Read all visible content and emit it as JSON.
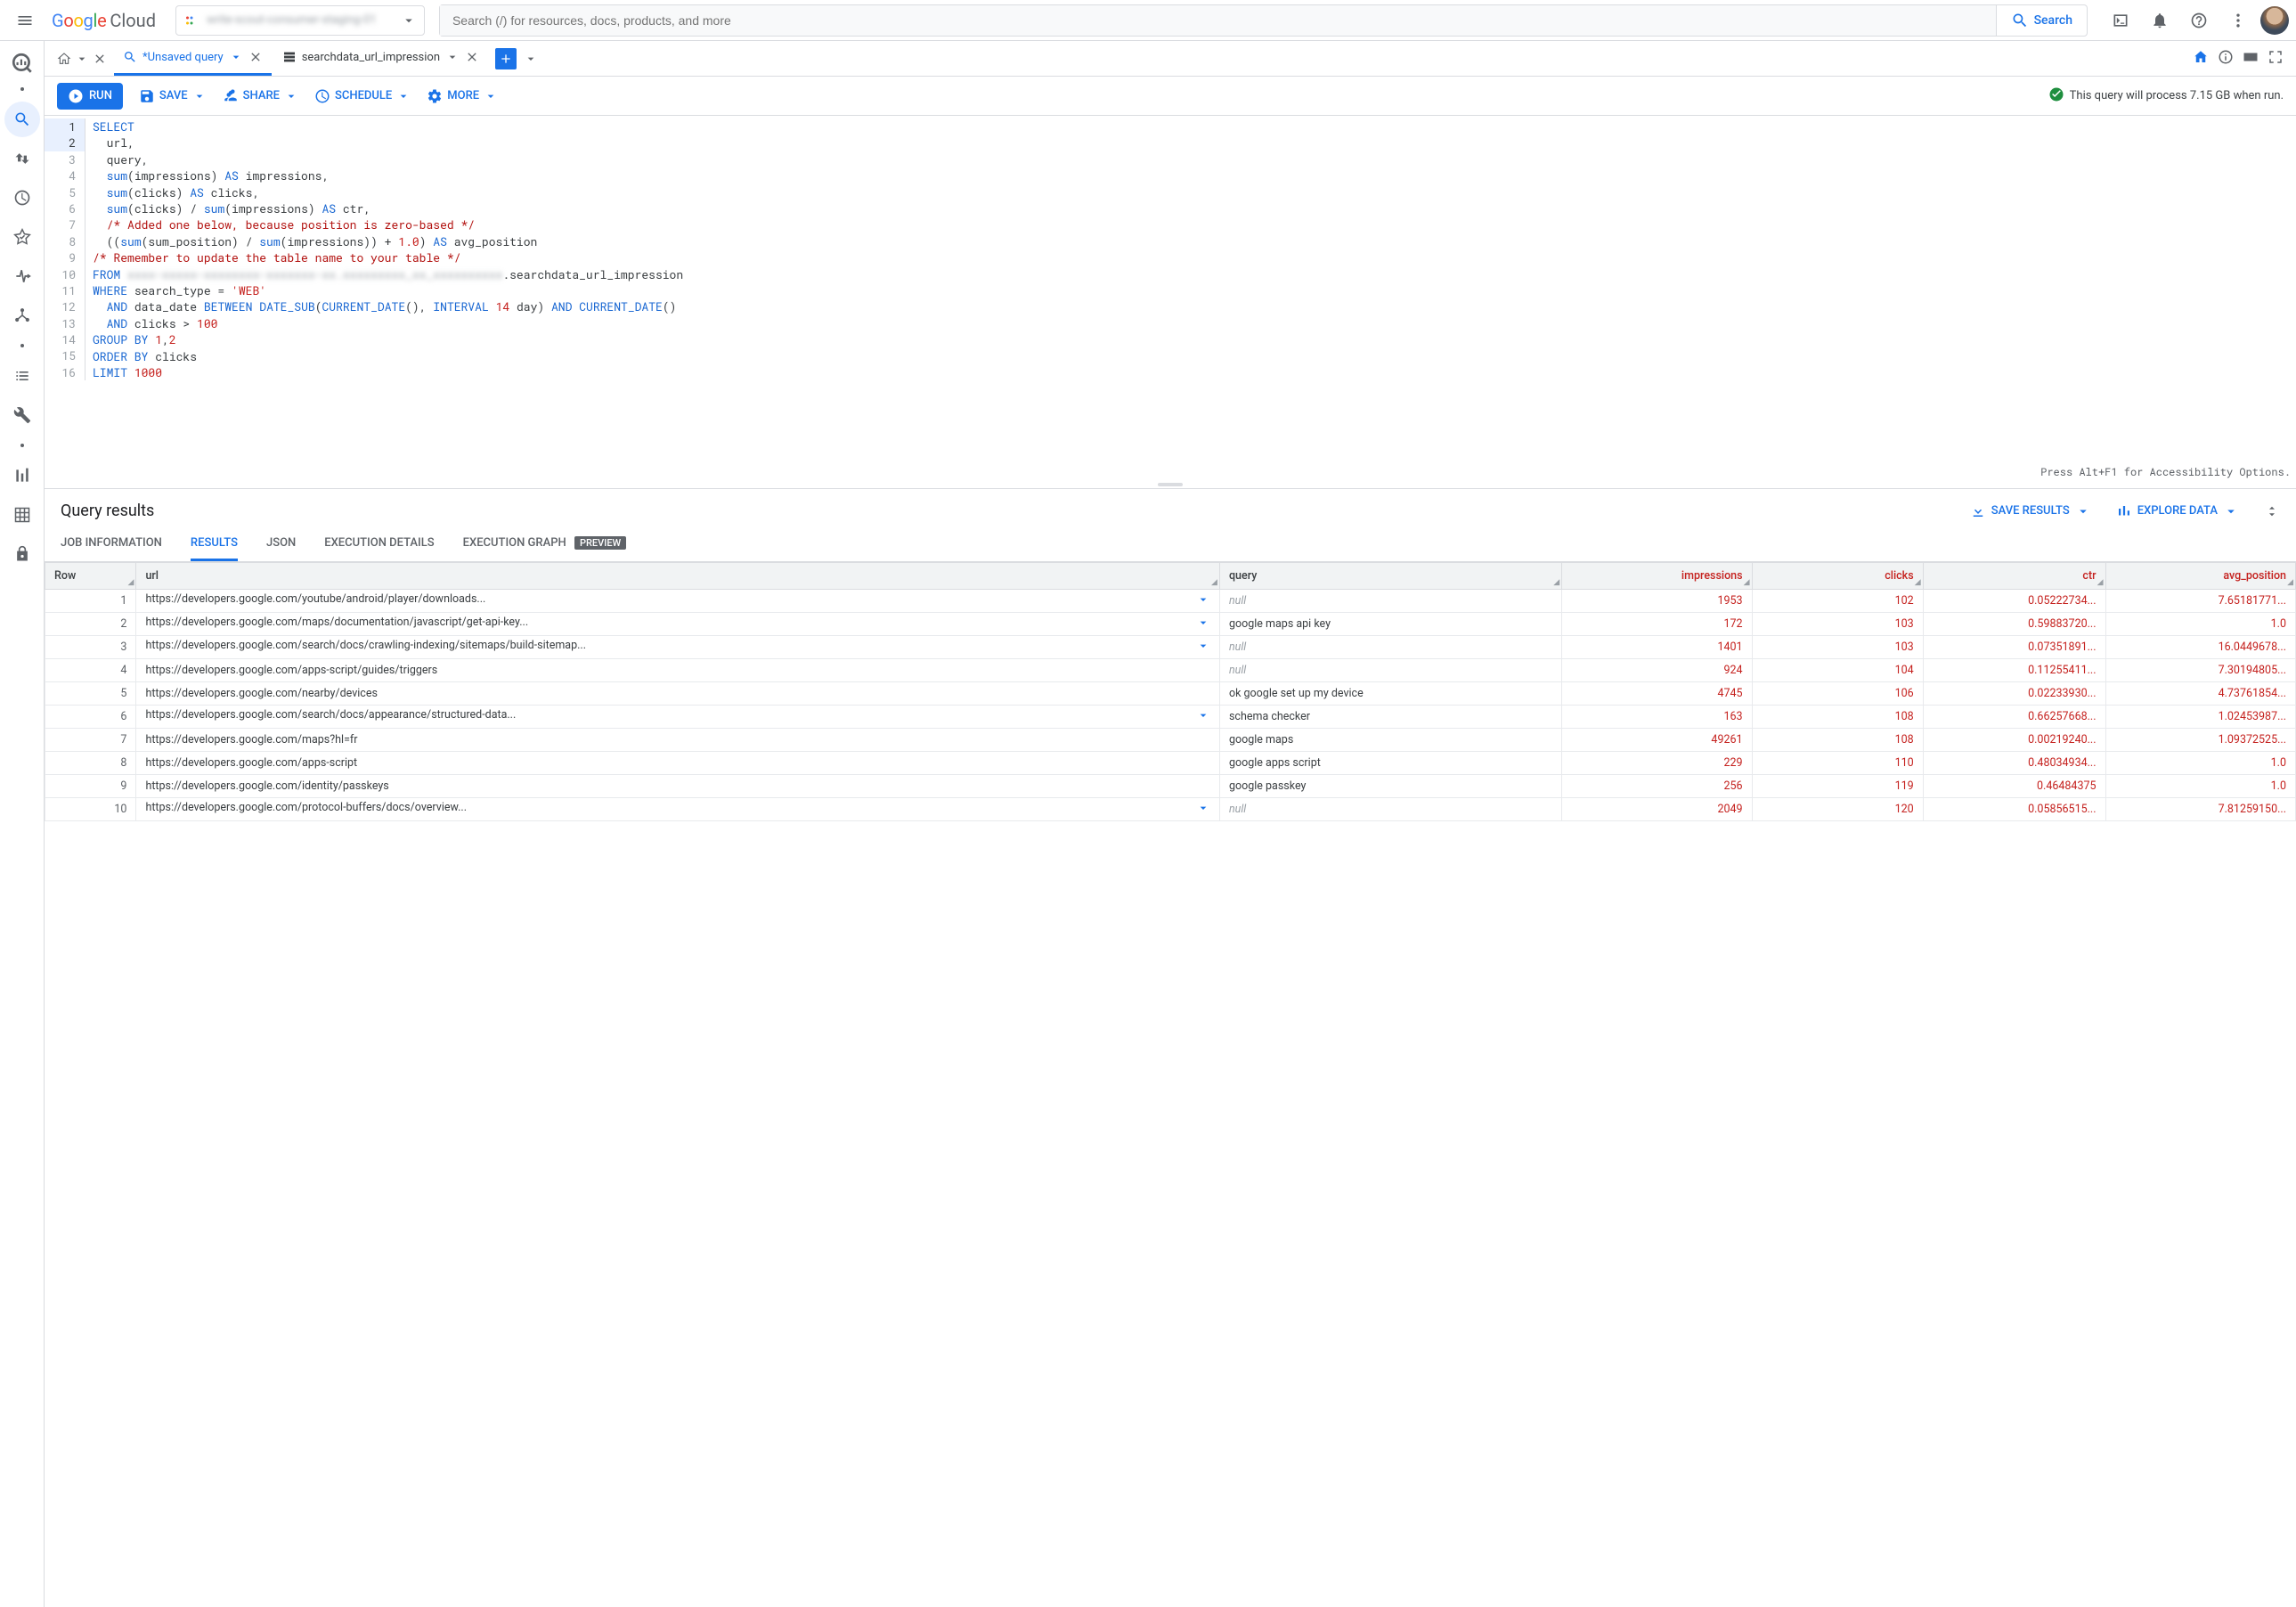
{
  "header": {
    "project_name_blurred": "write-scout-consumer-staging-01",
    "search_placeholder": "Search (/) for resources, docs, products, and more",
    "search_button": "Search"
  },
  "tabs": {
    "unsaved_label": "*Unsaved query",
    "table_label": "searchdata_url_impression"
  },
  "toolbar": {
    "run": "RUN",
    "save": "SAVE",
    "share": "SHARE",
    "schedule": "SCHEDULE",
    "more": "MORE",
    "valid_msg": "This query will process 7.15 GB when run."
  },
  "editor": {
    "a11y_hint": "Press Alt+F1 for Accessibility Options.",
    "lines": [
      {
        "n": 1,
        "h": true,
        "html": "<span class='kw'>SELECT</span>"
      },
      {
        "n": 2,
        "h": true,
        "html": "  url,"
      },
      {
        "n": 3,
        "html": "  query,"
      },
      {
        "n": 4,
        "html": "  <span class='fn'>sum</span>(impressions) <span class='kw'>AS</span> impressions,"
      },
      {
        "n": 5,
        "html": "  <span class='fn'>sum</span>(clicks) <span class='kw'>AS</span> clicks,"
      },
      {
        "n": 6,
        "html": "  <span class='fn'>sum</span>(clicks) / <span class='fn'>sum</span>(impressions) <span class='kw'>AS</span> ctr,"
      },
      {
        "n": 7,
        "html": "  <span class='cm'>/* Added one below, because position is zero-based */</span>"
      },
      {
        "n": 8,
        "html": "  ((<span class='fn'>sum</span>(sum_position) / <span class='fn'>sum</span>(impressions)) + <span class='num'>1.0</span>) <span class='kw'>AS</span> avg_position"
      },
      {
        "n": 9,
        "html": "<span class='cm'>/* Remember to update the table name to your table */</span>"
      },
      {
        "n": 10,
        "html": "<span class='kw'>FROM</span> <span class='blurred'>xxxx-xxxxx-xxxxxxxx-xxxxxxx-xx.xxxxxxxxx_xx_xxxxxxxxxx</span>.searchdata_url_impression"
      },
      {
        "n": 11,
        "html": "<span class='kw'>WHERE</span> search_type = <span class='str'>'WEB'</span>"
      },
      {
        "n": 12,
        "html": "  <span class='kw'>AND</span> data_date <span class='kw'>BETWEEN</span> <span class='fn'>DATE_SUB</span>(<span class='fn'>CURRENT_DATE</span>(), <span class='kw'>INTERVAL</span> <span class='num'>14</span> day) <span class='kw'>AND</span> <span class='fn'>CURRENT_DATE</span>()"
      },
      {
        "n": 13,
        "html": "  <span class='kw'>AND</span> clicks &gt; <span class='num'>100</span>"
      },
      {
        "n": 14,
        "html": "<span class='kw'>GROUP BY</span> <span class='num'>1</span>,<span class='num'>2</span>"
      },
      {
        "n": 15,
        "html": "<span class='kw'>ORDER BY</span> clicks"
      },
      {
        "n": 16,
        "html": "<span class='kw'>LIMIT</span> <span class='num'>1000</span>"
      }
    ]
  },
  "results": {
    "title": "Query results",
    "save_results": "SAVE RESULTS",
    "explore_data": "EXPLORE DATA",
    "tabs": {
      "job": "JOB INFORMATION",
      "results": "RESULTS",
      "json": "JSON",
      "exec_details": "EXECUTION DETAILS",
      "exec_graph": "EXECUTION GRAPH",
      "preview": "PREVIEW"
    },
    "columns": [
      "Row",
      "url",
      "query",
      "impressions",
      "clicks",
      "ctr",
      "avg_position"
    ],
    "rows": [
      {
        "n": 1,
        "url": "https://developers.google.com/youtube/android/player/downloads...",
        "exp": true,
        "query": null,
        "impressions": 1953,
        "clicks": 102,
        "ctr": "0.05222734...",
        "avg": "7.65181771..."
      },
      {
        "n": 2,
        "url": "https://developers.google.com/maps/documentation/javascript/get-api-key...",
        "exp": true,
        "query": "google maps api key",
        "impressions": 172,
        "clicks": 103,
        "ctr": "0.59883720...",
        "avg": "1.0"
      },
      {
        "n": 3,
        "url": "https://developers.google.com/search/docs/crawling-indexing/sitemaps/build-sitemap...",
        "exp": true,
        "query": null,
        "impressions": 1401,
        "clicks": 103,
        "ctr": "0.07351891...",
        "avg": "16.0449678..."
      },
      {
        "n": 4,
        "url": "https://developers.google.com/apps-script/guides/triggers",
        "exp": false,
        "query": null,
        "impressions": 924,
        "clicks": 104,
        "ctr": "0.11255411...",
        "avg": "7.30194805..."
      },
      {
        "n": 5,
        "url": "https://developers.google.com/nearby/devices",
        "exp": false,
        "query": "ok google set up my device",
        "impressions": 4745,
        "clicks": 106,
        "ctr": "0.02233930...",
        "avg": "4.73761854..."
      },
      {
        "n": 6,
        "url": "https://developers.google.com/search/docs/appearance/structured-data...",
        "exp": true,
        "query": "schema checker",
        "impressions": 163,
        "clicks": 108,
        "ctr": "0.66257668...",
        "avg": "1.02453987..."
      },
      {
        "n": 7,
        "url": "https://developers.google.com/maps?hl=fr",
        "exp": false,
        "query": "google maps",
        "impressions": 49261,
        "clicks": 108,
        "ctr": "0.00219240...",
        "avg": "1.09372525..."
      },
      {
        "n": 8,
        "url": "https://developers.google.com/apps-script",
        "exp": false,
        "query": "google apps script",
        "impressions": 229,
        "clicks": 110,
        "ctr": "0.48034934...",
        "avg": "1.0"
      },
      {
        "n": 9,
        "url": "https://developers.google.com/identity/passkeys",
        "exp": false,
        "query": "google passkey",
        "impressions": 256,
        "clicks": 119,
        "ctr": "0.46484375",
        "avg": "1.0"
      },
      {
        "n": 10,
        "url": "https://developers.google.com/protocol-buffers/docs/overview...",
        "exp": true,
        "query": null,
        "impressions": 2049,
        "clicks": 120,
        "ctr": "0.05856515...",
        "avg": "7.81259150..."
      }
    ]
  }
}
